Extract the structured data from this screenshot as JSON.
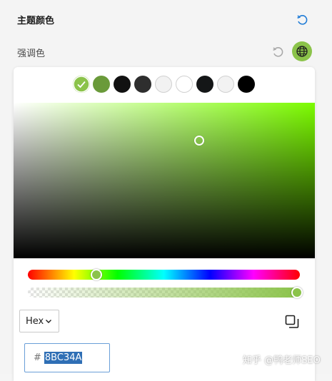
{
  "header": {
    "title": "主题颜色",
    "reset_icon": "reset-icon"
  },
  "accent": {
    "label": "强调色",
    "reset_icon": "reset-icon",
    "globe_icon": "globe-icon",
    "current_color": "#8BC34A"
  },
  "swatches": [
    {
      "color": "#8BC34A",
      "selected": true
    },
    {
      "color": "#6A9A3A",
      "selected": false
    },
    {
      "color": "#111111",
      "selected": false
    },
    {
      "color": "#2E2E2E",
      "selected": false
    },
    {
      "color": "#F2F2F2",
      "selected": false
    },
    {
      "color": "#FFFFFF",
      "selected": false
    },
    {
      "color": "#141617",
      "selected": false
    },
    {
      "color": "#F2F2F2",
      "selected": false
    },
    {
      "color": "#000000",
      "selected": false
    }
  ],
  "picker": {
    "hue_color": "#7CFC00",
    "format": "Hex",
    "hex_prefix": "#",
    "hex_value": "8BC34A",
    "copy_icon": "copy-icon"
  },
  "watermark": "知乎 @鸭老师SEO"
}
